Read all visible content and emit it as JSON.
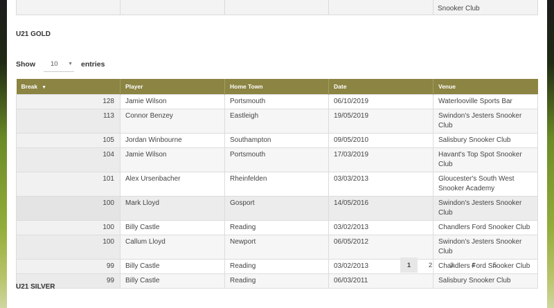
{
  "previous_table": {
    "cells": [
      "",
      "",
      "",
      "",
      "Snooker Club"
    ]
  },
  "sections": {
    "gold_title": "U21 GOLD",
    "silver_title": "U21 SILVER"
  },
  "length": {
    "show_label": "Show",
    "selected": "10",
    "entries_label": "entries"
  },
  "table": {
    "headers": {
      "break": "Break",
      "player": "Player",
      "hometown": "Home Town",
      "date": "Date",
      "venue": "Venue"
    },
    "rows": [
      {
        "break": "128",
        "player": "Jamie Wilson",
        "hometown": "Portsmouth",
        "date": "06/10/2019",
        "venue": "Waterlooville Sports Bar"
      },
      {
        "break": "113",
        "player": "Connor Benzey",
        "hometown": "Eastleigh",
        "date": "19/05/2019",
        "venue": "Swindon's Jesters Snooker Club"
      },
      {
        "break": "105",
        "player": "Jordan Winbourne",
        "hometown": "Southampton",
        "date": "09/05/2010",
        "venue": "Salisbury Snooker Club"
      },
      {
        "break": "104",
        "player": "Jamie Wilson",
        "hometown": "Portsmouth",
        "date": "17/03/2019",
        "venue": "Havant's Top Spot Snooker Club"
      },
      {
        "break": "101",
        "player": "Alex Ursenbacher",
        "hometown": "Rheinfelden",
        "date": "03/03/2013",
        "venue": "Gloucester's South West Snooker Academy"
      },
      {
        "break": "100",
        "player": "Mark Lloyd",
        "hometown": "Gosport",
        "date": "14/05/2016",
        "venue": "Swindon's Jesters Snooker Club"
      },
      {
        "break": "100",
        "player": "Billy Castle",
        "hometown": "Reading",
        "date": "03/02/2013",
        "venue": "Chandlers Ford Snooker Club"
      },
      {
        "break": "100",
        "player": "Callum Lloyd",
        "hometown": "Newport",
        "date": "06/05/2012",
        "venue": "Swindon's Jesters Snooker Club"
      },
      {
        "break": "99",
        "player": "Billy Castle",
        "hometown": "Reading",
        "date": "03/02/2013",
        "venue": "Chandlers Ford Snooker Club"
      },
      {
        "break": "99",
        "player": "Billy Castle",
        "hometown": "Reading",
        "date": "06/03/2011",
        "venue": "Salisbury Snooker Club"
      }
    ]
  },
  "pagination": {
    "pages": [
      "1",
      "2",
      "3",
      "4",
      "5"
    ],
    "current": "1"
  },
  "icons": {
    "sort": "sort-desc-icon",
    "select": "chevron-down-icon"
  }
}
